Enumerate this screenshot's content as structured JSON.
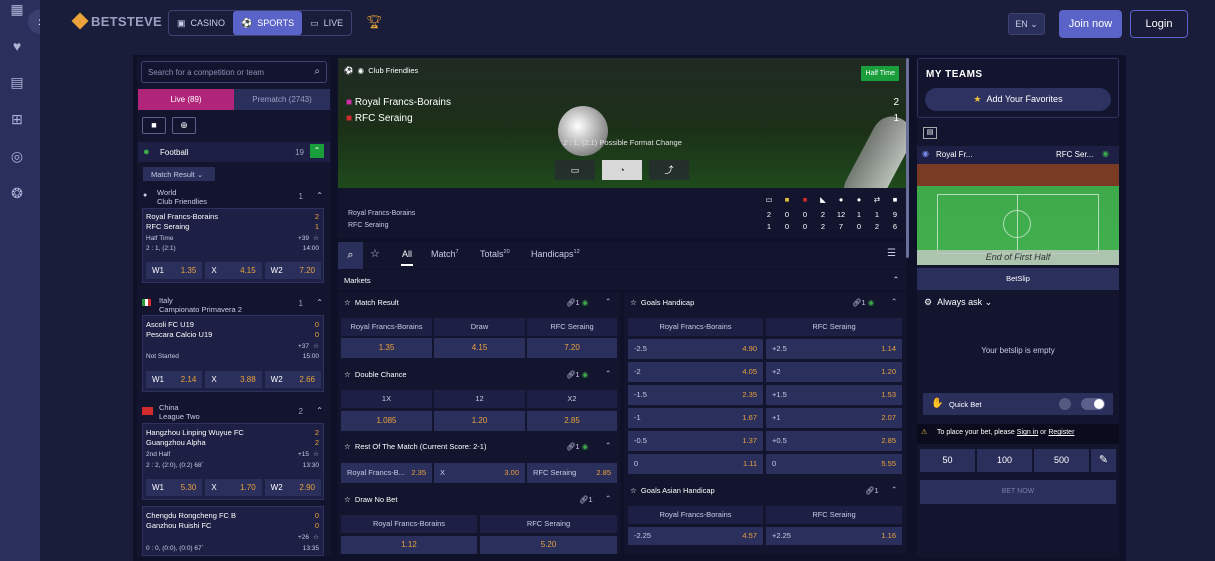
{
  "sidebar": {
    "icons": [
      "grid-icon",
      "heart-icon",
      "casino-icon",
      "gift-icon",
      "promo-icon",
      "help-icon"
    ]
  },
  "brand": {
    "logo": "BETSTEVE"
  },
  "nav": {
    "casino": "CASINO",
    "sports": "SPORTS",
    "live": "LIVE"
  },
  "header": {
    "lang": "EN",
    "join": "Join now",
    "login": "Login"
  },
  "left": {
    "search_placeholder": "Search for a competition or team",
    "tab_live": "Live (89)",
    "tab_prematch": "Prematch (2743)",
    "sport": "Football",
    "sport_count": "19",
    "market": "Match Result",
    "leagues": [
      {
        "line1": "World",
        "line2": "Club Friendlies",
        "count": "1"
      },
      {
        "line1": "Italy",
        "line2": "Campionato Primavera 2",
        "count": "1"
      },
      {
        "line1": "China",
        "line2": "League Two",
        "count": "2"
      }
    ],
    "matches": [
      {
        "home": "Royal Francs-Borains",
        "away": "RFC Seraing",
        "hs": "2",
        "as": "1",
        "status": "Half Time",
        "more": "+39",
        "score": "2 : 1, (2:1)",
        "time": "14:00",
        "w1": "1.35",
        "x": "4.15",
        "w2": "7.20"
      },
      {
        "home": "Ascoli FC U19",
        "away": "Pescara Calcio U19",
        "hs": "0",
        "as": "0",
        "status": "Not Started",
        "more": "+37",
        "score": "",
        "time": "15:00",
        "w1": "2.14",
        "x": "3.88",
        "w2": "2.66"
      },
      {
        "home": "Hangzhou Linping Wuyue FC",
        "away": "Guangzhou Alpha",
        "hs": "2",
        "as": "2",
        "status": "2nd Half",
        "more": "+15",
        "score": "2 : 2, (2:0), (0:2) 68`",
        "time": "13:30",
        "w1": "5.30",
        "x": "1.70",
        "w2": "2.90"
      },
      {
        "home": "Chengdu Rongcheng FC B",
        "away": "Ganzhou Ruishi FC",
        "hs": "0",
        "as": "0",
        "status": "",
        "more": "+26",
        "score": "0 : 0, (0:0), (0:0) 67`",
        "time": "13:35"
      }
    ],
    "odd_labels": {
      "w1": "W1",
      "x": "X",
      "w2": "W2"
    }
  },
  "match": {
    "competition": "Club Friendlies",
    "status": "Half Time",
    "home": "Royal Francs-Borains",
    "away": "RFC Seraing",
    "home_score": "2",
    "away_score": "1",
    "caption": "2 : 1, (2:1) Possible Format Change",
    "stats_home": [
      "2",
      "0",
      "0",
      "2",
      "12",
      "1",
      "1",
      "9"
    ],
    "stats_away": [
      "1",
      "0",
      "0",
      "2",
      "7",
      "0",
      "2",
      "6"
    ]
  },
  "tabs": {
    "all": "All",
    "match": "Match",
    "match_n": "7",
    "totals": "Totals",
    "totals_n": "20",
    "handicaps": "Handicaps",
    "handicaps_n": "12"
  },
  "markets_label": "Markets",
  "mr": {
    "title": "Match Result",
    "count": "1",
    "h": "Royal Francs-Borains",
    "d": "Draw",
    "a": "RFC Seraing",
    "o1": "1.35",
    "o2": "4.15",
    "o3": "7.20"
  },
  "dc": {
    "title": "Double Chance",
    "count": "1",
    "h": "1X",
    "d": "12",
    "a": "X2",
    "o1": "1.085",
    "o2": "1.20",
    "o3": "2.85"
  },
  "rm": {
    "title": "Rest Of The Match (Current Score: 2-1)",
    "count": "1",
    "h": "Royal Francs-B...",
    "ho": "2.35",
    "x": "X",
    "xo": "3.00",
    "a": "RFC Seraing",
    "ao": "2.85"
  },
  "dnb": {
    "title": "Draw No Bet",
    "count": "1",
    "h": "Royal Francs-Borains",
    "a": "RFC Seraing",
    "o1": "1.12",
    "o2": "5.20"
  },
  "gh": {
    "title": "Goals Handicap",
    "count": "1",
    "h": "Royal Francs-Borains",
    "a": "RFC Seraing",
    "rows": [
      [
        "-2.5",
        "4.90",
        "+2.5",
        "1.14"
      ],
      [
        "-2",
        "4.05",
        "+2",
        "1.20"
      ],
      [
        "-1.5",
        "2.35",
        "+1.5",
        "1.53"
      ],
      [
        "-1",
        "1.67",
        "+1",
        "2.07"
      ],
      [
        "-0.5",
        "1.37",
        "+0.5",
        "2.85"
      ],
      [
        "0",
        "1.11",
        "0",
        "5.55"
      ]
    ]
  },
  "gah": {
    "title": "Goals Asian Handicap",
    "count": "1",
    "h": "Royal Francs-Borains",
    "a": "RFC Seraing",
    "r1": [
      "-2.25",
      "4.57",
      "+2.25",
      "1.16"
    ]
  },
  "right": {
    "my_teams": "MY TEAMS",
    "add_fav": "Add Your Favorites",
    "p_home": "Royal Fr...",
    "p_away": "RFC Ser...",
    "pitch_caption": "End of First Half",
    "betslip": "BetSlip",
    "always_ask": "Always ask",
    "empty": "Your betslip is empty",
    "quick_bet": "Quick Bet",
    "warn_pre": "To place your bet, please",
    "sign_in": "Sign in",
    "or": "or",
    "register": "Register",
    "stakes": [
      "50",
      "100",
      "500"
    ],
    "bet_now": "BET NOW"
  }
}
